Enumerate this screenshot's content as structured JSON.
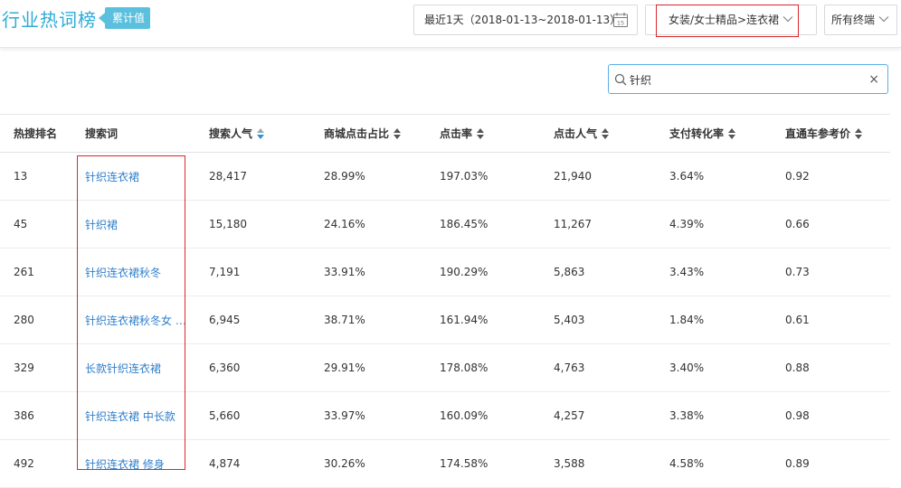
{
  "header": {
    "title": "行业热词榜",
    "badge": "累计值",
    "date_range": "最近1天（2018-01-13~2018-01-13）",
    "calendar_day": "15",
    "category": "女装/女士精品>连衣裙",
    "terminal": "所有终端"
  },
  "search": {
    "value": "针织"
  },
  "table": {
    "columns": [
      "热搜排名",
      "搜索词",
      "搜索人气",
      "商城点击占比",
      "点击率",
      "点击人气",
      "支付转化率",
      "直通车参考价"
    ],
    "rows": [
      [
        "13",
        "针织连衣裙",
        "28,417",
        "28.99%",
        "197.03%",
        "21,940",
        "3.64%",
        "0.92"
      ],
      [
        "45",
        "针织裙",
        "15,180",
        "24.16%",
        "186.45%",
        "11,267",
        "4.39%",
        "0.66"
      ],
      [
        "261",
        "针织连衣裙秋冬",
        "7,191",
        "33.91%",
        "190.29%",
        "5,863",
        "3.43%",
        "0.73"
      ],
      [
        "280",
        "针织连衣裙秋冬女 2...",
        "6,945",
        "38.71%",
        "161.94%",
        "5,403",
        "1.84%",
        "0.61"
      ],
      [
        "329",
        "长款针织连衣裙",
        "6,360",
        "29.91%",
        "178.08%",
        "4,763",
        "3.40%",
        "0.88"
      ],
      [
        "386",
        "针织连衣裙 中长款",
        "5,660",
        "33.97%",
        "160.09%",
        "4,257",
        "3.38%",
        "0.98"
      ],
      [
        "492",
        "针织连衣裙 修身",
        "4,874",
        "30.26%",
        "174.58%",
        "3,588",
        "4.58%",
        "0.89"
      ]
    ]
  },
  "colors": {
    "accent": "#2dabd8",
    "badge_bg": "#5bc0de",
    "link": "#2f7fcb",
    "highlight_box": "#d9262c"
  }
}
